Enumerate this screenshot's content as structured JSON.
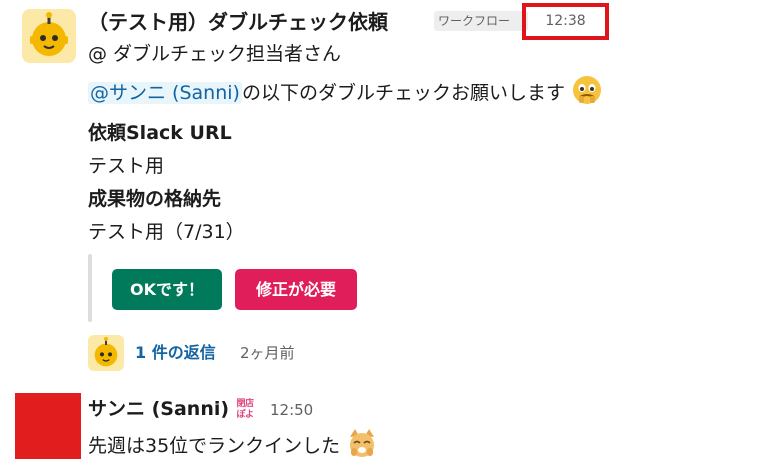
{
  "message1": {
    "title": "（テスト用）ダブルチェック依頼",
    "app_badge": "ワークフロー",
    "timestamp": "12:38",
    "line1": "@ ダブルチェック担当者さん",
    "mention": "@サンニ (Sanni)",
    "line2_rest": "の以下のダブルチェックお願いします",
    "label_url": "依頼Slack URL",
    "value_url": "テスト用",
    "label_location": "成果物の格納先",
    "value_location": "テスト用（7/31）",
    "buttons": {
      "ok": "OKです！",
      "fix": "修正が必要"
    },
    "replies": {
      "count": "1 件の返信",
      "time": "2ヶ月前"
    }
  },
  "message2": {
    "name": "サンニ (Sanni)",
    "status_emoji_text": "閉店\nぽよ",
    "time": "12:50",
    "text": "先週は35位でランクインした"
  },
  "colors": {
    "primary_button": "#007a5a",
    "danger_button": "#e01e5a",
    "link": "#1264a3",
    "highlight_box": "#e0141b",
    "avatar_red": "#e11d1d"
  }
}
